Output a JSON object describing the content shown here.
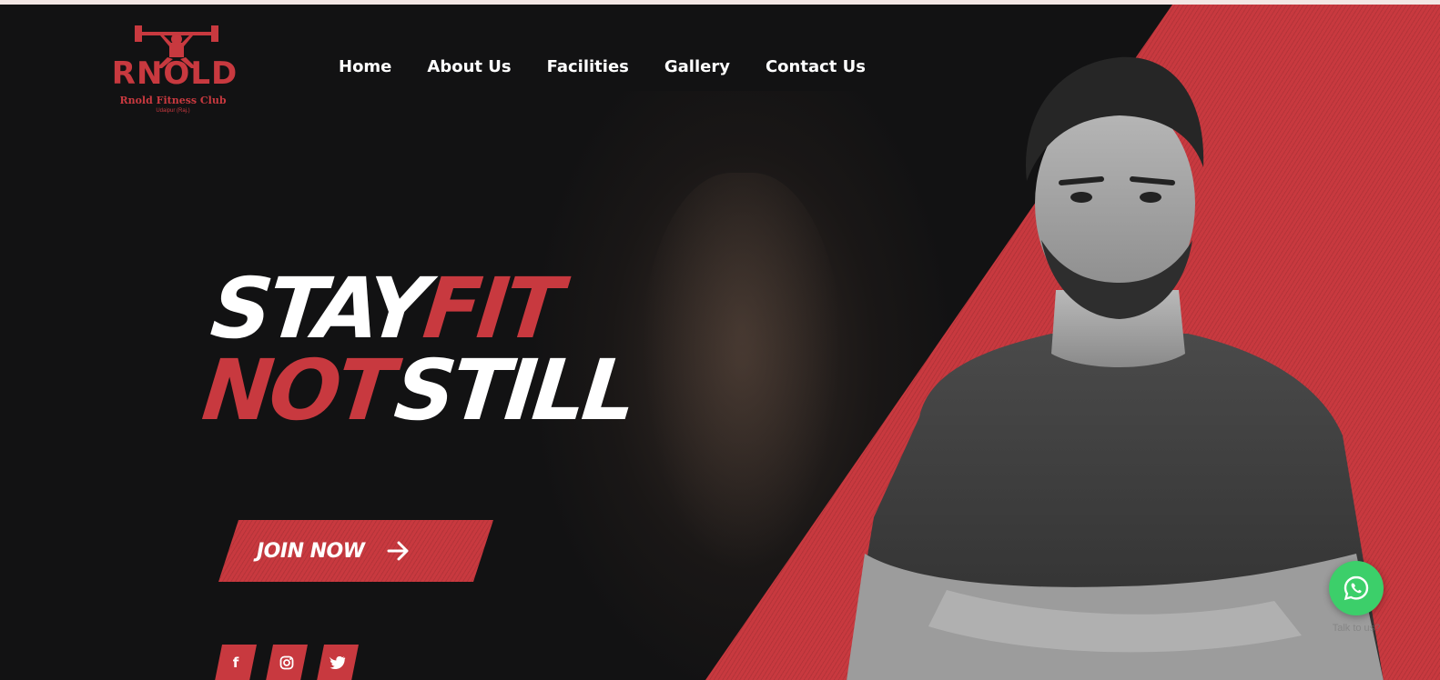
{
  "brand": {
    "logo_word": "RNOLD",
    "logo_name": "Rnold Fitness Club",
    "logo_city": "Udaipur (Raj.)"
  },
  "nav": {
    "items": [
      {
        "label": "Home"
      },
      {
        "label": "About Us"
      },
      {
        "label": "Facilities"
      },
      {
        "label": "Gallery"
      },
      {
        "label": "Contact Us"
      }
    ]
  },
  "hero": {
    "line1_white": "STAY",
    "line1_red": "FIT",
    "line2_red": "NOT",
    "line2_white": "STILL",
    "cta_label": "JOIN NOW"
  },
  "social": {
    "facebook": "f",
    "instagram": "instagram-icon",
    "twitter": "twitter-icon"
  },
  "whatsapp": {
    "caption": "Talk to us?"
  },
  "colors": {
    "accent": "#c8393f",
    "background": "#121213",
    "whatsapp": "#3ccf6a"
  }
}
